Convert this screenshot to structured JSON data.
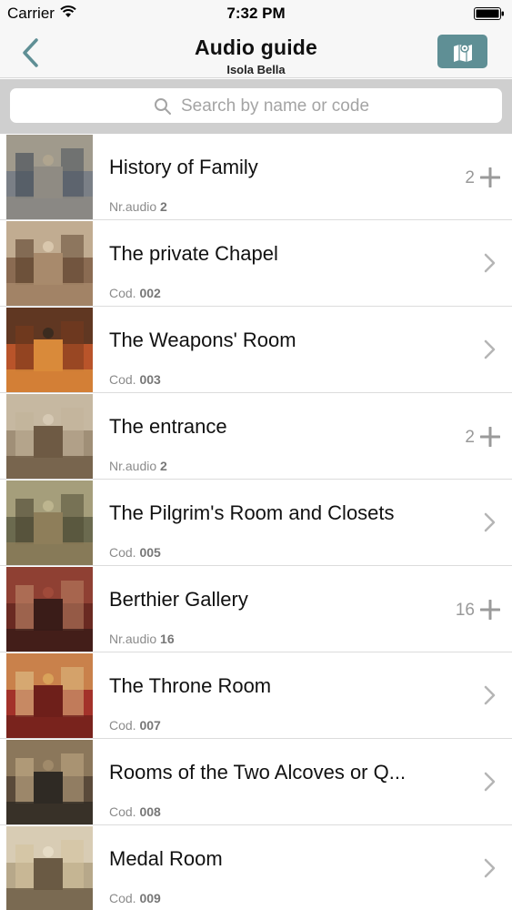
{
  "status_bar": {
    "carrier": "Carrier",
    "time": "7:32 PM"
  },
  "header": {
    "title": "Audio guide",
    "subtitle": "Isola Bella",
    "back_icon": "chevron-left-icon",
    "map_icon": "map-pin-icon"
  },
  "search": {
    "placeholder": "Search by name or code"
  },
  "colors": {
    "accent": "#5f8f95",
    "search_bg": "#cfcfcf"
  },
  "items": [
    {
      "title": "History of Family",
      "meta_label": "Nr.audio",
      "meta_value": "2",
      "count": "2",
      "action": "plus",
      "thumb_colors": [
        "#7a7f86",
        "#b0a58f",
        "#8f8b83",
        "#3f4a55"
      ]
    },
    {
      "title": "The private Chapel",
      "meta_label": "Cod.",
      "meta_value": "002",
      "count": "",
      "action": "chevron",
      "thumb_colors": [
        "#8a6b52",
        "#d9c7ad",
        "#a88a6c",
        "#5a3f2c"
      ]
    },
    {
      "title": "The Weapons' Room",
      "meta_label": "Cod.",
      "meta_value": "003",
      "count": "",
      "action": "chevron",
      "thumb_colors": [
        "#b9542a",
        "#3b2b1f",
        "#d98a3a",
        "#7a3a1c"
      ]
    },
    {
      "title": "The entrance",
      "meta_label": "Nr.audio",
      "meta_value": "2",
      "count": "2",
      "action": "plus",
      "thumb_colors": [
        "#a08f77",
        "#d6c9b4",
        "#6e5a44",
        "#c2b29a"
      ]
    },
    {
      "title": "The Pilgrim's Room and Closets",
      "meta_label": "Cod.",
      "meta_value": "005",
      "count": "",
      "action": "chevron",
      "thumb_colors": [
        "#6b6a4f",
        "#bdb58f",
        "#8e7e5a",
        "#4a4530"
      ]
    },
    {
      "title": "Berthier Gallery",
      "meta_label": "Nr.audio",
      "meta_value": "16",
      "count": "16",
      "action": "plus",
      "thumb_colors": [
        "#6a2a22",
        "#a04a3a",
        "#3a1c18",
        "#c08a6a"
      ]
    },
    {
      "title": "The Throne Room",
      "meta_label": "Cod.",
      "meta_value": "007",
      "count": "",
      "action": "chevron",
      "thumb_colors": [
        "#a3322a",
        "#d9a25a",
        "#6e1f1a",
        "#e0c38a"
      ]
    },
    {
      "title": "Rooms of the Two Alcoves or Q...",
      "meta_label": "Cod.",
      "meta_value": "008",
      "count": "",
      "action": "chevron",
      "thumb_colors": [
        "#5a4a3a",
        "#a08a6a",
        "#2f2a24",
        "#c8b08a"
      ]
    },
    {
      "title": "Medal Room",
      "meta_label": "Cod.",
      "meta_value": "009",
      "count": "",
      "action": "chevron",
      "thumb_colors": [
        "#b7a88a",
        "#e6dcc6",
        "#6a5a44",
        "#d4c29c"
      ]
    }
  ]
}
